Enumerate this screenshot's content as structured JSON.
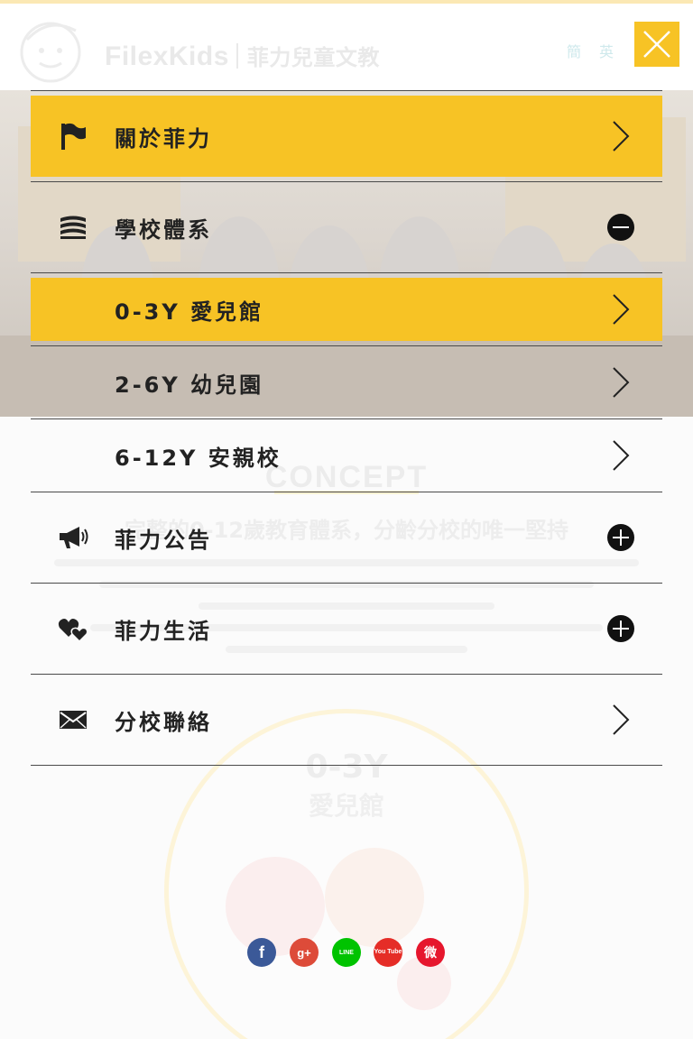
{
  "header": {
    "brand_name": "FilexKids",
    "brand_name_cn": "菲力兒童文教",
    "lang_options": [
      "簡",
      "英"
    ]
  },
  "close_button": {
    "icon": "close-icon"
  },
  "background": {
    "section_title": "CONCEPT",
    "section_subtitle": "完整的0-12歲教育體系，分齡分校的唯一堅持",
    "featured_age": "0-3Y",
    "featured_name": "愛兒館"
  },
  "menu": {
    "items": [
      {
        "label": "關於菲力",
        "icon": "flag-icon",
        "action": "chevron-right-icon",
        "active": true
      },
      {
        "label": "學校體系",
        "icon": "books-stack-icon",
        "action": "minus-circle-icon",
        "active": false
      },
      {
        "label": "0-3Y 愛兒館",
        "icon": "",
        "action": "chevron-right-icon",
        "active": true
      },
      {
        "label": "2-6Y 幼兒園",
        "icon": "",
        "action": "chevron-right-icon",
        "active": false
      },
      {
        "label": "6-12Y 安親校",
        "icon": "",
        "action": "chevron-right-icon",
        "active": false
      },
      {
        "label": "菲力公告",
        "icon": "megaphone-icon",
        "action": "plus-circle-icon",
        "active": false
      },
      {
        "label": "菲力生活",
        "icon": "hearts-icon",
        "action": "plus-circle-icon",
        "active": false
      },
      {
        "label": "分校聯絡",
        "icon": "envelope-icon",
        "action": "chevron-right-icon",
        "active": false
      }
    ]
  },
  "social": [
    {
      "name": "facebook-icon",
      "glyph": "f",
      "color": "#3b5998"
    },
    {
      "name": "google-plus-icon",
      "glyph": "g+",
      "color": "#dd4b39"
    },
    {
      "name": "line-icon",
      "glyph": "LINE",
      "color": "#00c300"
    },
    {
      "name": "youtube-icon",
      "glyph": "You Tube",
      "color": "#e52d27"
    },
    {
      "name": "weibo-icon",
      "glyph": "微",
      "color": "#e6162d"
    }
  ],
  "colors": {
    "accent": "#f7c325",
    "divider": "#4a4a4a",
    "text": "#222222"
  }
}
